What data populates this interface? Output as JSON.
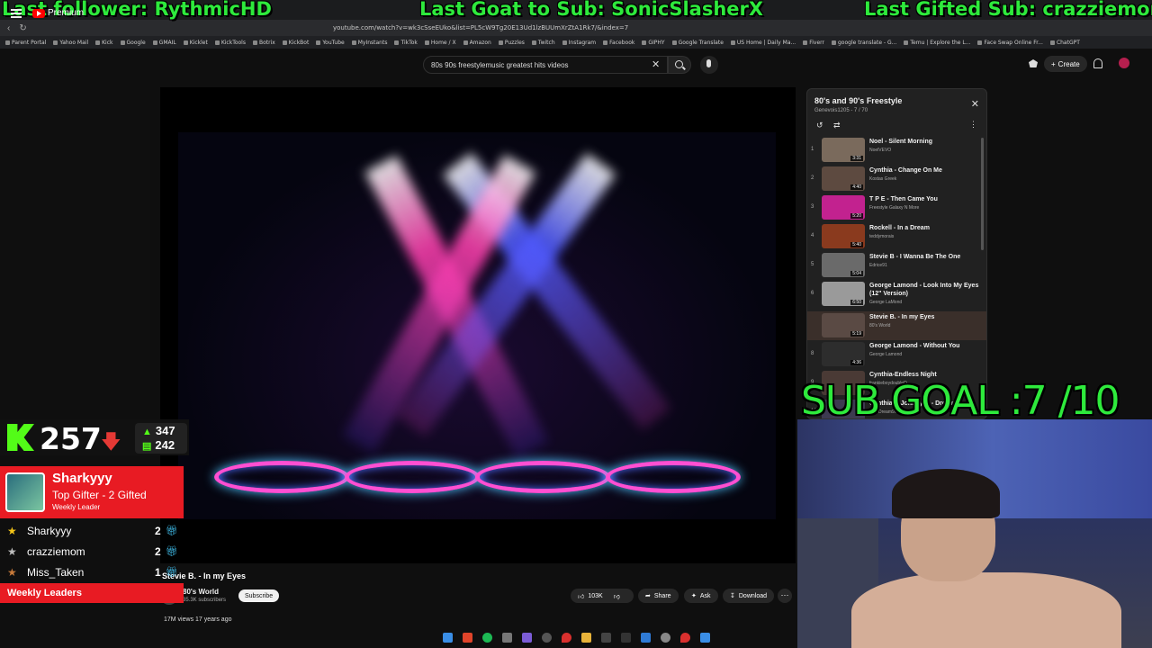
{
  "overlay": {
    "last_follower": "Last follower: RythmicHD",
    "last_goat": "Last Goat to Sub: SonicSlasherX",
    "last_gifted": "Last Gifted Sub: crazziemom",
    "sub_goal": "SUB GOAL :7 /10"
  },
  "browser": {
    "url": "youtube.com/watch?v=wk3cSseEUko&list=PL5cW9Tg20E13Ud1lzBUUmXrZtA1Rk7/&index=7",
    "bookmarks": [
      "Parent Portal",
      "Yahoo Mail",
      "Kick",
      "Google",
      "GMAIL",
      "Kicklet",
      "KickTools",
      "Botrix",
      "KickBot",
      "YouTube",
      "MyInstants",
      "TikTok",
      "Home / X",
      "Amazon",
      "Puzzles",
      "Twitch",
      "Instagram",
      "Facebook",
      "GIPHY",
      "Google Translate",
      "US Home | Daily Ma...",
      "Fiverr",
      "google translate - G...",
      "Temu | Explore the L...",
      "Face Swap Online Fr...",
      "ChatGPT"
    ]
  },
  "youtube": {
    "logo_label": "Premium",
    "search_query": "80s 90s freestylemusic greatest hits videos",
    "create_label": "Create"
  },
  "video": {
    "title": "Stevie B. - In my Eyes",
    "channel": "80's World",
    "subscribers": "35.3K subscribers",
    "subscribe_label": "Subscribe",
    "likes": "103K",
    "share_label": "Share",
    "ask_label": "Ask",
    "download_label": "Download",
    "views_line": "17M views  17 years ago"
  },
  "playlist": {
    "title": "80's and 90's Freestyle",
    "subtitle": "Genevois1205 - 7 / 70",
    "items": [
      {
        "num": "1",
        "song": "Noel - Silent Morning",
        "artist": "NoelVEVO",
        "duration": "3:31",
        "color": "#7a6a5c"
      },
      {
        "num": "2",
        "song": "Cynthia - Change On Me",
        "artist": "Kostas Greek",
        "duration": "4:40",
        "color": "#5d4a40"
      },
      {
        "num": "3",
        "song": "T P E - Then Came You",
        "artist": "Freestyle Galaxy N More",
        "duration": "5:20",
        "color": "#c2228f"
      },
      {
        "num": "4",
        "song": "Rockell - In a Dream",
        "artist": "teddymorais",
        "duration": "5:40",
        "color": "#8a3a1e"
      },
      {
        "num": "5",
        "song": "Stevie B - I Wanna Be The One",
        "artist": "Edrice91",
        "duration": "5:04",
        "color": "#6a6a6a"
      },
      {
        "num": "6",
        "song": "George Lamond - Look Into My Eyes (12\" Version)",
        "artist": "George LaMond",
        "duration": "6:50",
        "color": "#9a9a9a"
      },
      {
        "num": "",
        "song": "Stevie B. - In my Eyes",
        "artist": "80's World",
        "duration": "5:19",
        "color": "#5a4a44"
      },
      {
        "num": "8",
        "song": "George Lamond - Without You",
        "artist": "George Lamond",
        "duration": "4:36",
        "color": "#2d2d2d"
      },
      {
        "num": "9",
        "song": "Cynthia-Endless Night",
        "artist": "frankieboydoubleD",
        "duration": "",
        "color": "#4a3a35"
      },
      {
        "num": "10",
        "song": "Cynthia & Johnny O - Dream",
        "artist": "Boy Dream9ld",
        "duration": "",
        "color": "#3d3a50"
      }
    ]
  },
  "kick": {
    "count": "257",
    "up_count": "347",
    "bar_count": "242"
  },
  "gifter": {
    "name": "Sharkyyy",
    "subtitle": "Top Gifter - 2 Gifted",
    "weekly": "Weekly Leader"
  },
  "leaderboard": [
    {
      "name": "Sharkyyy",
      "count": "2",
      "star_color": "#f5c518"
    },
    {
      "name": "crazziemom",
      "count": "2",
      "star_color": "#bdbdbd"
    },
    {
      "name": "Miss_Taken",
      "count": "1",
      "star_color": "#c77a3a"
    }
  ],
  "weekly_leaders_label": "Weekly Leaders",
  "colors": {
    "overlay_green": "#2eea3c",
    "kick_green": "#53fc18",
    "accent_red": "#e81b23",
    "yt_red": "#ff0000"
  }
}
